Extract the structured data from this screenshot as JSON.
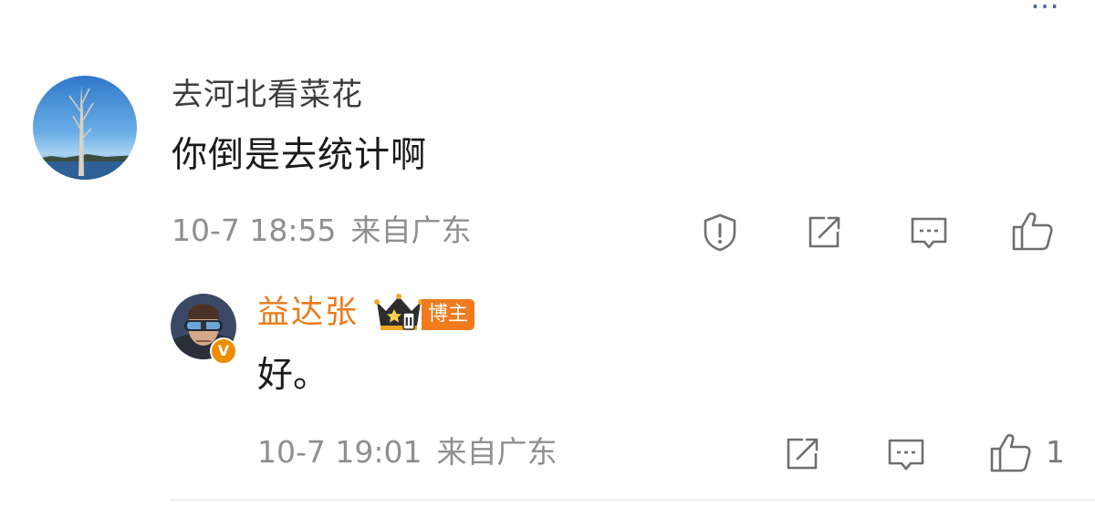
{
  "header": {
    "sort_label": "…"
  },
  "comment": {
    "username": "去河北看菜花",
    "text": "你倒是去统计啊",
    "time": "10-7 18:55",
    "location": "来自广东",
    "icons": [
      "report-icon",
      "repost-icon",
      "comment-icon",
      "like-icon"
    ]
  },
  "reply": {
    "username": "益达张",
    "badge_label": "博主",
    "verified_mark": "V",
    "crown_level": "II",
    "text": "好。",
    "time": "10-7 19:01",
    "location": "来自广东",
    "like_count": "1",
    "icons": [
      "repost-icon",
      "comment-icon",
      "like-icon"
    ]
  },
  "colors": {
    "link": "#4a6d99",
    "vip_name": "#eb7a1a",
    "badge_bg": "#f07a1c",
    "meta_text": "#8f8f8f",
    "icon_stroke": "#6f6f6f"
  }
}
